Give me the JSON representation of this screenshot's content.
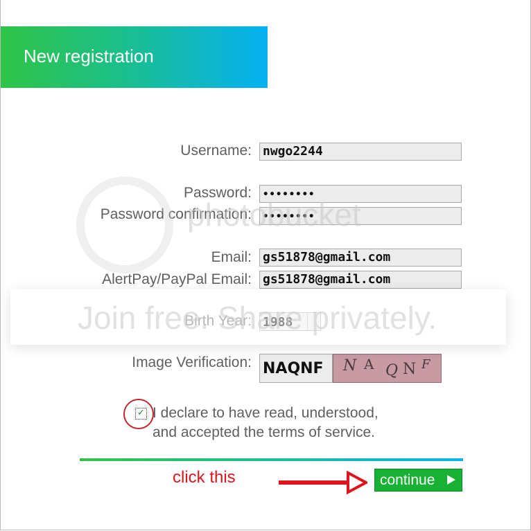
{
  "header": {
    "title": "New registration"
  },
  "form": {
    "username_label": "Username:",
    "username_value": "nwgo2244",
    "password_label": "Password:",
    "password_value": "••••••••",
    "password_confirm_label": "Password confirmation:",
    "password_confirm_value": "••••••••",
    "email_label": "Email:",
    "email_value": "gs51878@gmail.com",
    "paypal_label": "AlertPay/PayPal Email:",
    "paypal_value": "gs51878@gmail.com",
    "birth_year_label": "Birth Year:",
    "birth_year_value": "1988",
    "image_verification_label": "Image Verification:",
    "captcha_value": "NAQNF",
    "captcha_chars": [
      "N",
      "A",
      "Q",
      "N",
      "F"
    ],
    "terms_checked": true,
    "terms_line1": "I declare to have read, understood,",
    "terms_line2": "and accepted the terms of service."
  },
  "annotation": {
    "click_note": "click this"
  },
  "actions": {
    "continue_label": "continue"
  },
  "watermark": {
    "brand": "photobucket",
    "tagline": "Join free. Share privately."
  },
  "colors": {
    "gradient_start": "#2fc446",
    "gradient_end": "#06b1f3",
    "continue_button": "#17b234",
    "annotation_red": "#e0141c",
    "label_gray": "#5f5f5f"
  }
}
